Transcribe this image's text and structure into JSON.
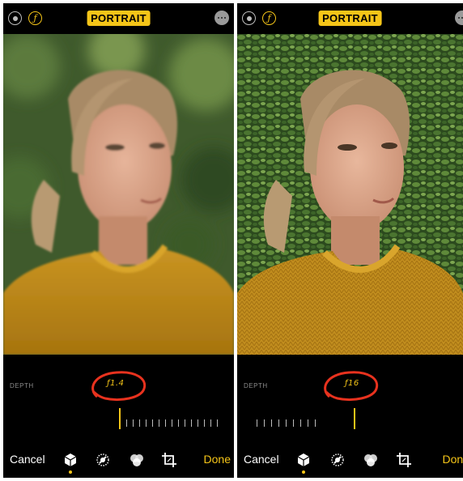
{
  "panels": [
    {
      "id": "left",
      "mode_badge": "PORTRAIT",
      "f_icon": "ƒ",
      "depth_label": "DEPTH",
      "aperture": "ƒ1.4",
      "cancel_label": "Cancel",
      "done_label": "Done",
      "background": "blurred"
    },
    {
      "id": "right",
      "mode_badge": "PORTRAIT",
      "f_icon": "ƒ",
      "depth_label": "DEPTH",
      "aperture": "ƒ16",
      "cancel_label": "Cancel",
      "done_label": "Done",
      "background": "sharp"
    }
  ],
  "icons": {
    "live": "live-photo-icon",
    "aperture": "aperture-f-icon",
    "more": "more-options-icon",
    "portrait_lighting": "portrait-lighting-cube-icon",
    "adjust": "adjust-dial-icon",
    "filters": "filters-icon",
    "crop": "crop-icon"
  },
  "colors": {
    "accent": "#f5c518",
    "annotation": "#e8321e",
    "background": "#000000"
  }
}
